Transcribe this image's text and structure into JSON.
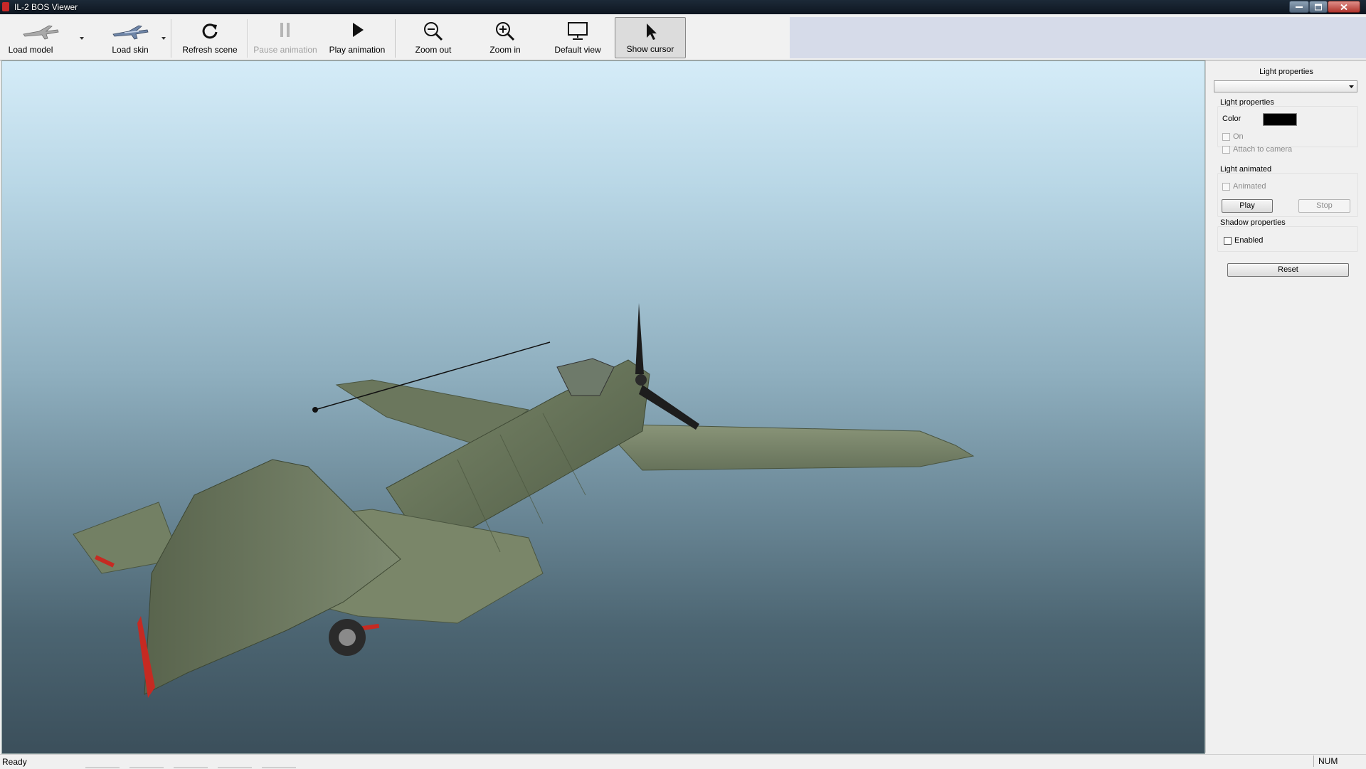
{
  "window": {
    "title": "IL-2 BOS Viewer"
  },
  "toolbar": {
    "load_model": "Load model",
    "load_skin": "Load skin",
    "refresh_scene": "Refresh scene",
    "pause_animation": "Pause animation",
    "play_animation": "Play animation",
    "zoom_out": "Zoom out",
    "zoom_in": "Zoom in",
    "default_view": "Default view",
    "show_cursor": "Show cursor"
  },
  "panel": {
    "header": "Light properties",
    "light_select_value": "",
    "light_props_title": "Light properties",
    "color_label": "Color",
    "color_value": "#000000",
    "on_label": "On",
    "attach_label": "Attach to camera",
    "light_animated_title": "Light animated",
    "animated_label": "Animated",
    "play_label": "Play",
    "stop_label": "Stop",
    "shadow_title": "Shadow properties",
    "enabled_label": "Enabled",
    "reset_label": "Reset"
  },
  "statusbar": {
    "status": "Ready",
    "num": "NUM"
  },
  "colors": {
    "viewport_top": "#d5ecf8",
    "viewport_bottom": "#3b4f5b",
    "aircraft": "#5e6b50",
    "markings": "#c62a22"
  }
}
